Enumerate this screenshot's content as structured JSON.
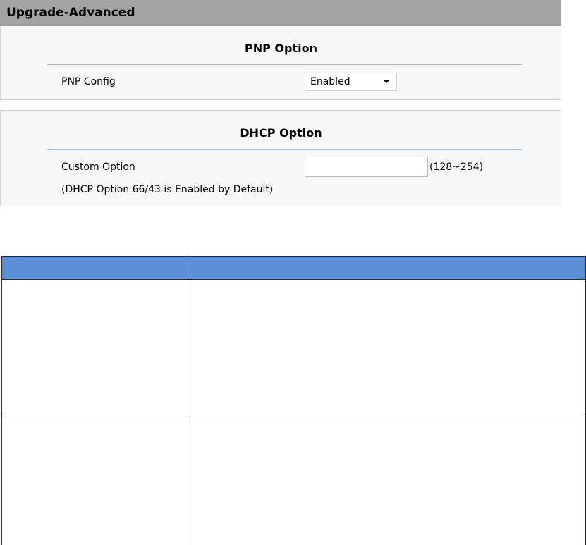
{
  "header": {
    "title": "Upgrade-Advanced"
  },
  "pnp_section": {
    "title": "PNP Option",
    "config_label": "PNP Config",
    "config_value": "Enabled",
    "config_options": [
      "Enabled"
    ]
  },
  "dhcp_section": {
    "title": "DHCP Option",
    "custom_label": "Custom Option",
    "custom_value": "",
    "range_hint": "(128~254)",
    "note": "(DHCP Option 66/43 is Enabled by Default)"
  },
  "doc_table": {
    "header_color": "#5b8fd6",
    "headers": [
      "",
      ""
    ],
    "rows": [
      [
        "",
        ""
      ],
      [
        "",
        ""
      ]
    ]
  }
}
